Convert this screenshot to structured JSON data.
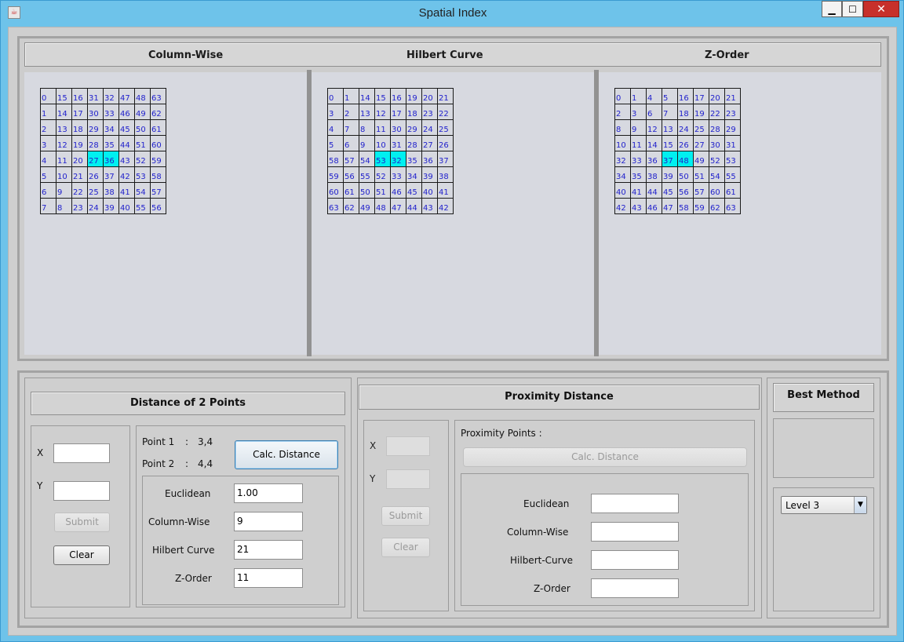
{
  "window": {
    "title": "Spatial Index",
    "minimize": "▁",
    "maximize": "☐",
    "close": "✕"
  },
  "headers": {
    "column_wise": "Column-Wise",
    "hilbert": "Hilbert Curve",
    "zorder": "Z-Order"
  },
  "grids": {
    "column_wise": [
      [
        "0",
        "15",
        "16",
        "31",
        "32",
        "47",
        "48",
        "63"
      ],
      [
        "1",
        "14",
        "17",
        "30",
        "33",
        "46",
        "49",
        "62"
      ],
      [
        "2",
        "13",
        "18",
        "29",
        "34",
        "45",
        "50",
        "61"
      ],
      [
        "3",
        "12",
        "19",
        "28",
        "35",
        "44",
        "51",
        "60"
      ],
      [
        "4",
        "11",
        "20",
        "27",
        "36",
        "43",
        "52",
        "59"
      ],
      [
        "5",
        "10",
        "21",
        "26",
        "37",
        "42",
        "53",
        "58"
      ],
      [
        "6",
        "9",
        "22",
        "25",
        "38",
        "41",
        "54",
        "57"
      ],
      [
        "7",
        "8",
        "23",
        "24",
        "39",
        "40",
        "55",
        "56"
      ]
    ],
    "hilbert": [
      [
        "0",
        "1",
        "14",
        "15",
        "16",
        "19",
        "20",
        "21"
      ],
      [
        "3",
        "2",
        "13",
        "12",
        "17",
        "18",
        "23",
        "22"
      ],
      [
        "4",
        "7",
        "8",
        "11",
        "30",
        "29",
        "24",
        "25"
      ],
      [
        "5",
        "6",
        "9",
        "10",
        "31",
        "28",
        "27",
        "26"
      ],
      [
        "58",
        "57",
        "54",
        "53",
        "32",
        "35",
        "36",
        "37"
      ],
      [
        "59",
        "56",
        "55",
        "52",
        "33",
        "34",
        "39",
        "38"
      ],
      [
        "60",
        "61",
        "50",
        "51",
        "46",
        "45",
        "40",
        "41"
      ],
      [
        "63",
        "62",
        "49",
        "48",
        "47",
        "44",
        "43",
        "42"
      ]
    ],
    "zorder": [
      [
        "0",
        "1",
        "4",
        "5",
        "16",
        "17",
        "20",
        "21"
      ],
      [
        "2",
        "3",
        "6",
        "7",
        "18",
        "19",
        "22",
        "23"
      ],
      [
        "8",
        "9",
        "12",
        "13",
        "24",
        "25",
        "28",
        "29"
      ],
      [
        "10",
        "11",
        "14",
        "15",
        "26",
        "27",
        "30",
        "31"
      ],
      [
        "32",
        "33",
        "36",
        "37",
        "48",
        "49",
        "52",
        "53"
      ],
      [
        "34",
        "35",
        "38",
        "39",
        "50",
        "51",
        "54",
        "55"
      ],
      [
        "40",
        "41",
        "44",
        "45",
        "56",
        "57",
        "60",
        "61"
      ],
      [
        "42",
        "43",
        "46",
        "47",
        "58",
        "59",
        "62",
        "63"
      ]
    ],
    "highlight_row": 4,
    "highlight_cols": [
      3,
      4
    ],
    "highlight_color": "#00f0f0",
    "text_color": "#2222cc"
  },
  "distance_panel": {
    "title": "Distance of 2 Points",
    "x_label": "X",
    "y_label": "Y",
    "x_value": "",
    "y_value": "",
    "submit": "Submit",
    "clear": "Clear",
    "point1_label": "Point 1",
    "point1_sep": ":",
    "point1_value": "3,4",
    "point2_label": "Point 2",
    "point2_sep": ":",
    "point2_value": "4,4",
    "calc_button": "Calc. Distance",
    "euclidean_label": "Euclidean",
    "euclidean_value": "1.00",
    "column_wise_label": "Column-Wise",
    "column_wise_value": "9",
    "hilbert_label": "Hilbert Curve",
    "hilbert_value": "21",
    "zorder_label": "Z-Order",
    "zorder_value": "11"
  },
  "proximity_panel": {
    "title": "Proximity Distance",
    "x_label": "X",
    "y_label": "Y",
    "submit": "Submit",
    "clear": "Clear",
    "points_label": "Proximity Points  :",
    "calc_button": "Calc. Distance",
    "euclidean_label": "Euclidean",
    "column_wise_label": "Column-Wise",
    "hilbert_label": "Hilbert-Curve",
    "zorder_label": "Z-Order"
  },
  "best_method": {
    "title": "Best Method",
    "level_value": "Level 3",
    "arrow": "▼"
  }
}
